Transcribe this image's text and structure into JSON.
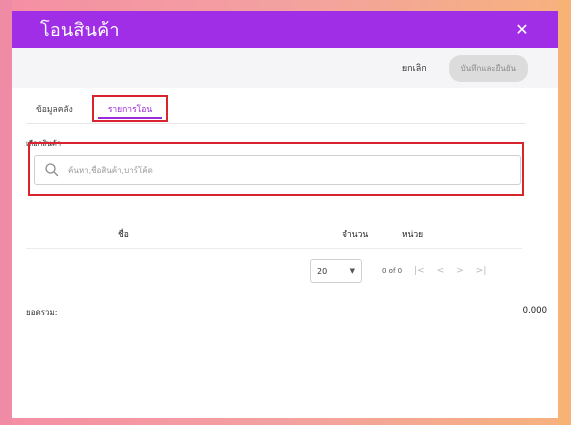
{
  "dialog": {
    "title": "โอนสินค้า",
    "close_icon": "close-icon"
  },
  "actions": {
    "cancel_label": "ยกเลิก",
    "save_confirm_label": "บันทึกและยืนยัน"
  },
  "tabs": [
    {
      "label": "ข้อมูลคลัง",
      "active": false
    },
    {
      "label": "รายการโอน",
      "active": true
    }
  ],
  "product_select": {
    "label": "เลือกสินค้า",
    "placeholder": "ค้นหา,ชื่อสินค้า,บาร์โค้ด"
  },
  "table": {
    "columns": [
      "ชื่อ",
      "จำนวน",
      "หน่วย"
    ],
    "rows": []
  },
  "pagination": {
    "rows_per_page": "20",
    "range_text": "0 of 0"
  },
  "summary": {
    "total_label": "ยอดรวม:",
    "total_value": "0.000"
  },
  "colors": {
    "header": "#a02ee6",
    "highlight": "#d8242c",
    "active_tab": "#9b2ad8"
  }
}
